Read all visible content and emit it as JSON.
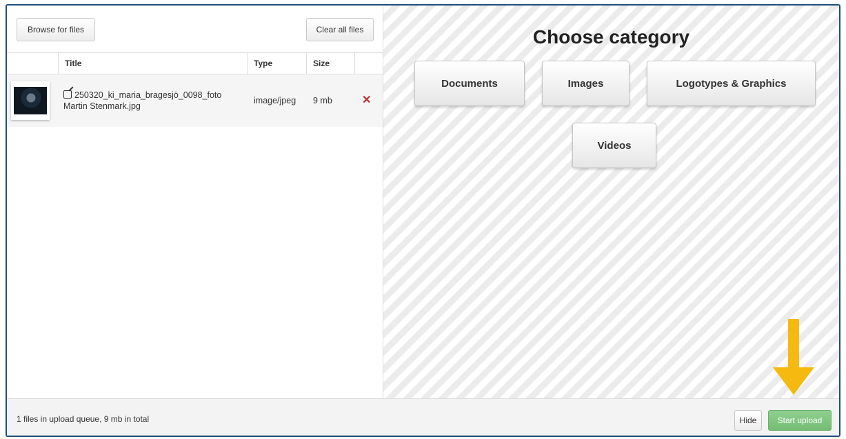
{
  "toolbar": {
    "browse_label": "Browse for files",
    "clear_label": "Clear all files"
  },
  "table": {
    "headers": [
      "Title",
      "Type",
      "Size"
    ],
    "rows": [
      {
        "title_line1": "250320_ki_maria_bragesjö_0098_foto",
        "title_line2": "Martin Stenmark.jpg",
        "type": "image/jpeg",
        "size": "9 mb",
        "remove": "✕"
      }
    ]
  },
  "category": {
    "heading": "Choose category",
    "options": [
      "Documents",
      "Images",
      "Logotypes & Graphics",
      "Videos"
    ]
  },
  "footer": {
    "queue_text": "1 files in upload queue, 9 mb in total",
    "hide_label": "Hide",
    "start_label": "Start upload"
  },
  "colors": {
    "frame_border": "#1f4e79",
    "start_button": "#74bc74",
    "remove_icon": "#c0262b",
    "arrow": "#f5b90f"
  },
  "icons": {
    "edit": "edit-icon",
    "remove": "close-icon",
    "arrow": "arrow-down-icon"
  }
}
